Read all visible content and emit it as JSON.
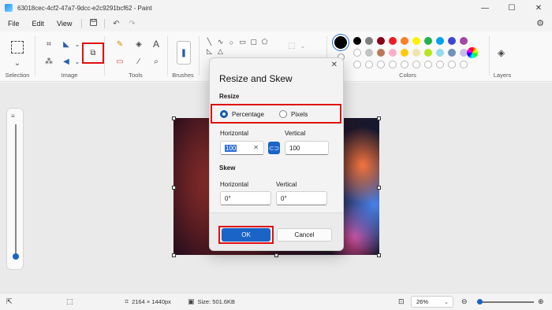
{
  "window": {
    "title": "63018cec-4cf2-47a7-9dcc-e2c9291bcf62 - Paint",
    "minimize": "—",
    "maximize": "☐",
    "close": "✕"
  },
  "menu": {
    "items": [
      "File",
      "Edit",
      "View"
    ],
    "save_icon": "save-icon",
    "undo_icon": "undo-icon",
    "redo_icon": "redo-icon",
    "settings_icon": "gear-icon"
  },
  "ribbon": {
    "groups": {
      "selection": "Selection",
      "image": "Image",
      "tools": "Tools",
      "brushes": "Brushes",
      "colors": "Colors",
      "layers": "Layers"
    },
    "colors": {
      "row1": [
        "#000000",
        "#7f7f7f",
        "#880015",
        "#ed1c24",
        "#ff7f27",
        "#fff200",
        "#22b14c",
        "#00a2e8",
        "#3f48cc",
        "#a349a4"
      ],
      "row2": [
        "#ffffff",
        "#c3c3c3",
        "#b97a57",
        "#ffaec9",
        "#ffc90e",
        "#efe4b0",
        "#b5e61d",
        "#99d9ea",
        "#7092be",
        "#c8bfe7"
      ]
    }
  },
  "dialog": {
    "title": "Resize and Skew",
    "close_icon": "✕",
    "resize_label": "Resize",
    "percentage_label": "Percentage",
    "pixels_label": "Pixels",
    "horizontal_label": "Horizontal",
    "vertical_label": "Vertical",
    "horizontal_value": "100",
    "vertical_value": "100",
    "skew_label": "Skew",
    "skew_horizontal_label": "Horizontal",
    "skew_vertical_label": "Vertical",
    "skew_horizontal_value": "0°",
    "skew_vertical_value": "0°",
    "ok_label": "OK",
    "cancel_label": "Cancel",
    "accent": "#1a63c7",
    "highlight": "#e01010"
  },
  "status": {
    "dimensions": "2164 × 1440px",
    "size": "Size: 501.6KB",
    "zoom": "26%",
    "zoom_slider_fraction": 0.26
  }
}
